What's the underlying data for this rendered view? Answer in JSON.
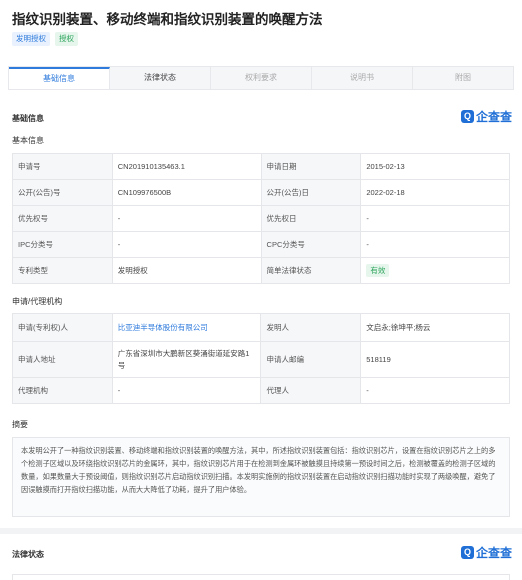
{
  "title": "指纹识别装置、移动终端和指纹识别装置的唤醒方法",
  "tags": [
    "发明授权",
    "授权"
  ],
  "tabs": [
    "基础信息",
    "法律状态",
    "权利要求",
    "说明书",
    "附图"
  ],
  "active_tab": "基础信息",
  "section_basic": "基础信息",
  "brand": "企查查",
  "subsection_basic": "基本信息",
  "basic_rows": [
    [
      "申请号",
      "CN201910135463.1",
      "申请日期",
      "2015-02-13"
    ],
    [
      "公开(公告)号",
      "CN109976500B",
      "公开(公告)日",
      "2022-02-18"
    ],
    [
      "优先权号",
      "-",
      "优先权日",
      "-"
    ],
    [
      "IPC分类号",
      "-",
      "CPC分类号",
      "-"
    ],
    [
      "专利类型",
      "发明授权",
      "简单法律状态",
      "有效"
    ]
  ],
  "subsection_agency": "申请/代理机构",
  "agency_rows": [
    [
      "申请(专利权)人",
      "比亚迪半导体股份有限公司",
      "发明人",
      "文启永;徐坤平;杨云"
    ],
    [
      "申请人地址",
      "广东省深圳市大鹏新区葵涌街道延安路1号",
      "申请人邮编",
      "518119"
    ],
    [
      "代理机构",
      "-",
      "代理人",
      "-"
    ]
  ],
  "abstract_label": "摘要",
  "abstract": "本发明公开了一种指纹识别装置、移动终端和指纹识别装置的唤醒方法，其中，所述指纹识别装置包括：指纹识别芯片，设置在指纹识别芯片之上的多个检测子区域以及环绕指纹识别芯片的金属环，其中，指纹识别芯片用于在检测到金属环被触摸且持续第一预设时间之后，检测被覆盖的检测子区域的数量，如果数量大于预设阈值，则指纹识别芯片启动指纹识别扫描。本发明实施例的指纹识别装置在启动指纹识别扫描功能时实现了两级唤醒，避免了因误触摸而打开指纹扫描功能，从而大大降低了功耗，提升了用户体验。",
  "section_legal": "法律状态"
}
